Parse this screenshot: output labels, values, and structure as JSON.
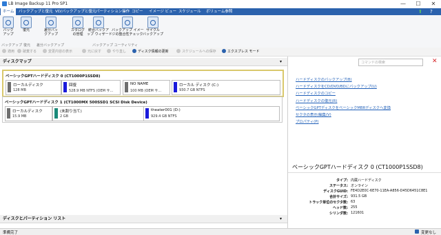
{
  "window": {
    "title": "LB Image Backup 11 Pro SP1",
    "minimize": "—",
    "maximize": "☐",
    "close": "✕"
  },
  "menubar": {
    "items": [
      "ホーム",
      "バックアップと復元",
      "VD/バックアップと復元",
      "パーティション操作",
      "コピー",
      "イメージ ビュー",
      "スケジュール",
      "ボリューム参照"
    ],
    "active_index": 1
  },
  "ribbon": {
    "buttons": [
      "バック\nアップ",
      "復元",
      "差分バッ\nクアップ",
      "カタログ\nの管理",
      "統合バックア\nップ ウィザード",
      "バックアップ イメー\nジの整合性チェック",
      "サイクル\nバックアップ"
    ],
    "groups": [
      "バックアップ",
      "復元",
      "差分バックアップ",
      "バックアップ ユーティリティ"
    ]
  },
  "toolbar": {
    "items": [
      "適用",
      "破棄する",
      "変更内容の表示",
      "元に戻す",
      "やり直し",
      "ディスク情報の更新",
      "スケジュールへの保存",
      "エクスプレス モード"
    ],
    "enabled": [
      false,
      false,
      false,
      false,
      false,
      true,
      false,
      true
    ]
  },
  "left": {
    "disk_map_header": "ディスクマップ",
    "partition_list_header": "ディスクとパーティション リスト",
    "disks": [
      {
        "title": "ベーシックGPTハードディスク 0 (CT1000P1SSD8)",
        "selected": true,
        "partitions": [
          {
            "name": "ローカルディスク",
            "size": "128 MB",
            "color": "#6e6e6e"
          },
          {
            "name": "回復",
            "size": "528.9 MB NTFS (OEM サ...",
            "color": "#1a1adb"
          },
          {
            "name": "NO NAME",
            "size": "100 MB (OEM サ...",
            "color": "#6e6e6e"
          },
          {
            "name": "ローカル ディスク (C:)",
            "size": "930.7 GB NTFS",
            "color": "#1a1adb"
          }
        ]
      },
      {
        "title": "ベーシックGPTハードディスク 1 (CT1000MX 500SSD1 SCSI Disk Device)",
        "selected": false,
        "partitions": [
          {
            "name": "ローカルディスク",
            "size": "15.9 MB",
            "color": "#6e6e6e"
          },
          {
            "name": "(未割り当て)",
            "size": "2 GB",
            "color": "#1a8a7a"
          },
          {
            "name": "theater001 (D:)",
            "size": "929.4 GB NTFS",
            "color": "#1a1adb"
          }
        ]
      }
    ]
  },
  "right": {
    "search_placeholder": "コマンドの検索",
    "close_icon": "✕",
    "links": [
      "ハードディスクのバックアップ(B)",
      "ハードディスクをCD/DVD/BDにバックアップ(U)",
      "ハードディスクのコピー",
      "ハードディスクの復元(R)",
      "ベーシックGPTディスクをベーシックMBRディスクへ変換",
      "セクタの表示/編集(V)",
      "プロパティ(P)"
    ],
    "detail_title": "ベーシックGPTハードディスク 0 (CT1000P1SSD8)",
    "props": [
      {
        "k": "タイプ:",
        "v": "内蔵ハードディスク"
      },
      {
        "k": "ステータス:",
        "v": "オンライン"
      },
      {
        "k": "ディスクGUID:",
        "v": "FE4D2E0C-6E70-11EA-A856-D45D6451C8E1"
      },
      {
        "k": "合計サイズ:",
        "v": "931.5 GB"
      },
      {
        "k": "トラック単位のセクタ数:",
        "v": "63"
      },
      {
        "k": "ヘッド数:",
        "v": "255"
      },
      {
        "k": "シリンダ数:",
        "v": "121601"
      }
    ]
  },
  "status": {
    "left": "準備完了",
    "right": "変更なし"
  }
}
